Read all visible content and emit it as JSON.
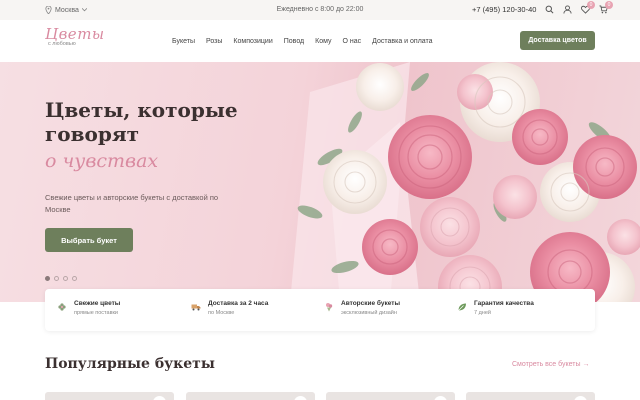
{
  "topbar": {
    "city": "Москва",
    "hours": "Ежедневно с 8:00 до 22:00",
    "phone": "+7 (495) 120-30-40",
    "favorites_count": "0",
    "cart_count": "0"
  },
  "header": {
    "logo_text": "Цветы",
    "logo_sub": "с любовью",
    "nav": [
      "Букеты",
      "Розы",
      "Композиции",
      "Повод",
      "Кому",
      "О нас",
      "Доставка и оплата"
    ],
    "cta": "Доставка цветов"
  },
  "hero": {
    "title_line1": "Цветы, которые",
    "title_line2": "говорят",
    "title_script": "о чувствах",
    "description": "Свежие цветы и авторские букеты с доставкой по Москве",
    "button": "Выбрать букет",
    "slides_total": 4,
    "slide_active": 1
  },
  "features": [
    {
      "title": "Свежие цветы",
      "sub": "прямые поставки",
      "icon": "flower-icon"
    },
    {
      "title": "Доставка за 2 часа",
      "sub": "по Москве",
      "icon": "truck-icon"
    },
    {
      "title": "Авторские букеты",
      "sub": "эксклюзивный дизайн",
      "icon": "bouquet-icon"
    },
    {
      "title": "Гарантия качества",
      "sub": "7 дней",
      "icon": "leaf-icon"
    }
  ],
  "popular": {
    "title": "Популярные букеты",
    "link": "Смотреть все букеты →"
  },
  "colors": {
    "accent_green": "#6e7f5c",
    "accent_pink": "#d98aa0",
    "hero_bg": "#f4d3d9"
  }
}
